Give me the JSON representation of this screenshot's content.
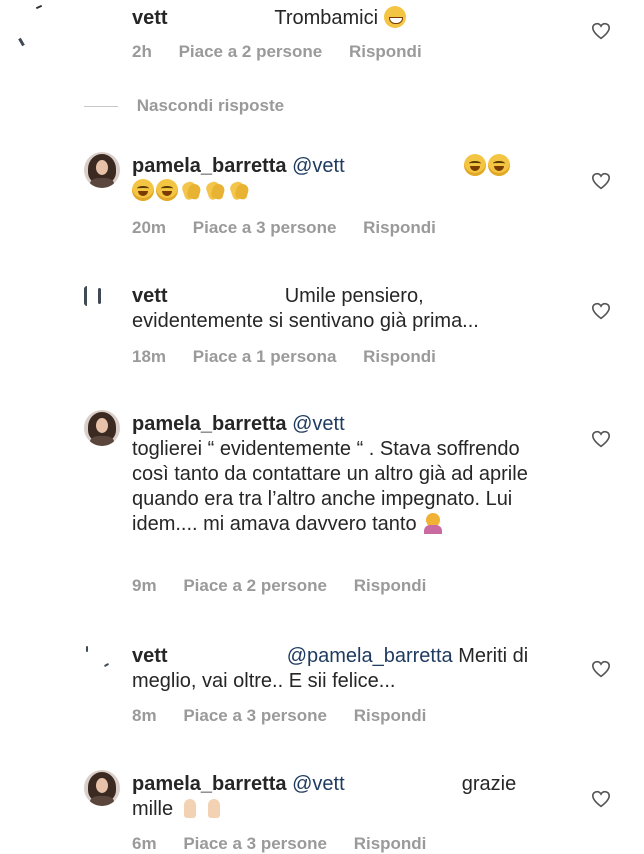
{
  "hide_replies": "Nascondi risposte",
  "comments": [
    {
      "user": "vett",
      "mention": "",
      "text_1": "Trombamici",
      "text_2": "",
      "time": "2h",
      "likes": "Piace a 2 persone",
      "reply": "Rispondi",
      "emoji": [
        "grin"
      ]
    },
    {
      "user": "pamela_barretta",
      "mention": "@vett",
      "text_1": "",
      "text_2": "",
      "time": "20m",
      "likes": "Piace a 3 persone",
      "reply": "Rispondi",
      "emoji": [
        "laugh",
        "laugh",
        "laugh",
        "laugh",
        "clap",
        "clap",
        "clap"
      ]
    },
    {
      "user": "vett",
      "mention": "",
      "text_1": "Umile pensiero,",
      "text_2": "evidentemente si sentivano già prima...",
      "time": "18m",
      "likes": "Piace a 1 persona",
      "reply": "Rispondi",
      "emoji": []
    },
    {
      "user": "pamela_barretta",
      "mention": "@vett",
      "text_1": "toglierei “ evidentemente “ . Stava soffrendo così tanto da contattare un altro già ad aprile quando era tra l’altro anche impegnato. Lui idem.... mi amava davvero tanto",
      "text_2": "",
      "time": "9m",
      "likes": "Piace a 2 persone",
      "reply": "Rispondi",
      "emoji": [
        "person"
      ]
    },
    {
      "user": "vett",
      "mention": "@pamela_barretta",
      "text_1": "Meriti di meglio, vai oltre.. E sii felice...",
      "text_2": "",
      "time": "8m",
      "likes": "Piace a 3 persone",
      "reply": "Rispondi",
      "emoji": []
    },
    {
      "user": "pamela_barretta",
      "mention": "@vett",
      "text_1": "grazie",
      "text_2": "mille",
      "time": "6m",
      "likes": "Piace a 3 persone",
      "reply": "Rispondi",
      "emoji": [
        "pray",
        "pray"
      ]
    }
  ]
}
